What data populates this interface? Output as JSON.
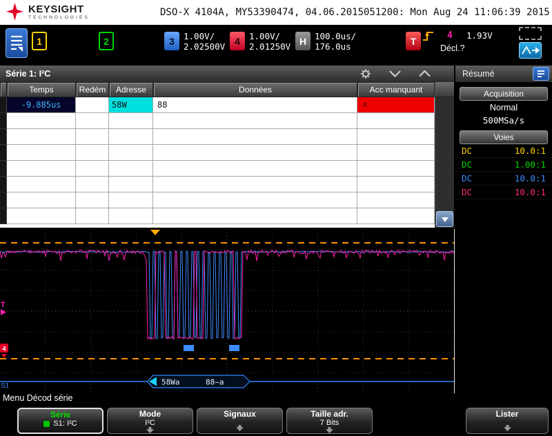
{
  "colors": {
    "brand_red": "#e90029",
    "ch1_yellow": "#ffd400",
    "ch2_green": "#00d800",
    "ch3_blue": "#3f8cff",
    "ch4_magenta": "#ff1fb0",
    "trigger_orange": "#ff9100",
    "missing_ack_red": "#ee0000",
    "address_cyan": "#00dede"
  },
  "header": {
    "brand": "KEYSIGHT",
    "brand_sub": "TECHNOLOGIES",
    "title": "DSO-X 4104A, MY53390474, 04.06.2015051200: Mon Aug 24 11:06:39 2015"
  },
  "status_bar": {
    "ch1_label": "1",
    "ch2_label": "2",
    "ch3": {
      "label": "3",
      "scale": "1.00V/",
      "offset": "2.02500V"
    },
    "ch4": {
      "label": "4",
      "scale": "1.00V/",
      "offset": "2.01250V"
    },
    "horizontal": {
      "label": "H",
      "timebase": "100.0us/",
      "delay": "176.0us"
    },
    "trigger": {
      "label": "T",
      "source": "4",
      "level": "1.93V",
      "status": "Décl.?"
    }
  },
  "decode_panel": {
    "title": "Série 1: I²C",
    "columns": [
      "Temps",
      "Redém",
      "Adresse",
      "Données",
      "Acc manquant"
    ],
    "row": {
      "temps": "-9.885us",
      "redem": "",
      "adresse": "58W",
      "donnees": "88",
      "acc_manquant": "X"
    }
  },
  "summary": {
    "title": "Résumé",
    "acquisition_button": "Acquisition",
    "acquisition_mode": "Normal",
    "sample_rate": "500MSa/s",
    "channels_button": "Voies",
    "channels": [
      {
        "coupling": "DC",
        "probe": "10.0:1"
      },
      {
        "coupling": "DC",
        "probe": "1.00:1"
      },
      {
        "coupling": "DC",
        "probe": "10.0:1"
      },
      {
        "coupling": "DC",
        "probe": "10.0:1"
      }
    ]
  },
  "waveform": {
    "bus_address": "58Wa",
    "bus_data": "88~a",
    "markers": {
      "trigger": "T",
      "ch4": "4",
      "serial": "S1"
    }
  },
  "menu": {
    "title": "Menu Décod série",
    "serie": {
      "label": "Série",
      "value": "S1: I²C"
    },
    "mode": {
      "label": "Mode",
      "value": "I²C"
    },
    "signaux": {
      "label": "Signaux"
    },
    "taille": {
      "label": "Taille adr.",
      "value": "7 Bits"
    },
    "lister": {
      "label": "Lister"
    }
  }
}
